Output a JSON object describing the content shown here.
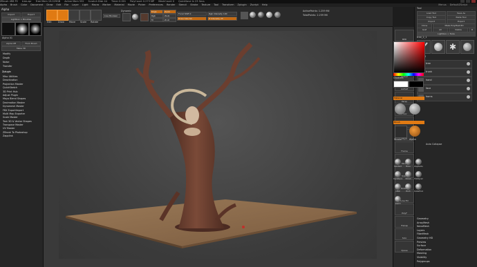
{
  "titlebar": {
    "items": [
      "ZBrush 4R8 P2",
      "tree.zpr",
      "Free Mem 19.029GB",
      "Active Mem 552",
      "Scratch Disk 44",
      "Timer 0.001",
      "PolyCount 0.273 MP",
      "MeshCount 0",
      "QuickSave In 23 Secs"
    ]
  },
  "menubar": {
    "items": [
      "Alpha",
      "Brush",
      "Color",
      "Document",
      "Draw",
      "Edit",
      "File",
      "Layer",
      "Light",
      "Macro",
      "Marker",
      "Material",
      "Movie",
      "Picker",
      "Preferences",
      "Render",
      "Stencil",
      "Stroke",
      "Texture",
      "Tool",
      "Transform",
      "Zplugin",
      "Zscript",
      "Help"
    ],
    "right_items": [
      "Menus",
      "DefaultZScript"
    ]
  },
  "left_panel": {
    "title": "Alpha",
    "lightbox_label": "Lightbox > Brushes",
    "brush_label": "Alpha 01",
    "buttons": [
      "Import",
      "Export",
      "Alpha Off",
      "From Brush",
      "Make 3D"
    ],
    "plugins_header": "Zplugin",
    "plugins": [
      "Misc Utilities",
      "Deactivation",
      "Projection Master",
      "QuickSketch",
      "3D Print Hub",
      "Adjust Plugin",
      "Maya Blend Shapes",
      "Decimation Master",
      "Dynamesh Master",
      "FBX ExportImport",
      "Multi Map Exporter",
      "Scale Master",
      "Text 3D & Vector Shapes",
      "Transpose Master",
      "UV Master",
      "ZBrush To Photoshop",
      "Zapplink"
    ],
    "top_list": [
      "Modify",
      "Depth",
      "Noise",
      "Transfer"
    ]
  },
  "toolbar": {
    "mode_labels": [
      "Edit",
      "Draw",
      "Move",
      "Scale",
      "Rotate"
    ],
    "livebool_label": "Live Boolean",
    "dynamic_label": "Dynamic",
    "mrgb_label": "Mrgb",
    "rgb_label": "Rgb",
    "m_label": "M",
    "zadd_label": "Zadd",
    "zsub_label": "Zsub",
    "zcut_label": "Zcut",
    "focal_shift": "Focal Shift 0",
    "draw_size": "Draw Size 64",
    "rgb_intensity": "Rgb Intensity 100",
    "z_intensity": "Z Intensity 25",
    "active_points": "ActivePoints: 1.259 Mil",
    "total_points": "TotalPoints: 2.259 Mil",
    "persp_label": "Persp",
    "floor_label": "Floor"
  },
  "shelf_labels": [
    "BPR",
    "Scroll",
    "Zoom",
    "Actual",
    "AAHalf",
    "Persp",
    "Floor",
    "Local",
    "LSym",
    "Frame",
    "Move",
    "Scale",
    "Rotate",
    "Line Fill",
    "PolyF",
    "Transp",
    "Solo",
    "Xpose"
  ],
  "right_panel": {
    "header": "Tool",
    "buttons": [
      "Load Tool",
      "Save As",
      "Copy Tool",
      "Paste Tool",
      "Import",
      "Export",
      "Clone",
      "Make PolyMesh3D",
      "GoZ",
      "All",
      "Visible",
      "R"
    ],
    "lightbox_label": "Lightbox > Tools",
    "tool_name": "tree_2_1",
    "subtool_header": "Subtool",
    "subtool_items": [
      "tree",
      "trunk",
      "hand",
      "face",
      "horns"
    ],
    "menu_items": [
      "Geometry",
      "ArrayMesh",
      "NanoMesh",
      "Layers",
      "FiberMesh",
      "Geometry HD",
      "Preview",
      "Surface",
      "Deformation",
      "Masking",
      "Visibility",
      "Polygroups"
    ],
    "color_section": "Color",
    "gradient_label": "Gradient",
    "switch_label": "SwitchColor",
    "alternate_label": "Alternate",
    "material_label": "Material",
    "brush_section": "Brush",
    "brush_labels": [
      "Standard",
      "Move",
      "ClayBuildup",
      "DamStandard",
      "hPolish",
      "TrimDynamic",
      "Inflat",
      "Pinch",
      "SnakeHook",
      "Slash3"
    ],
    "fill_label": "FillObject",
    "pickup_label": "PickUp",
    "stroke_label": "Stroke",
    "alpha_label": "Alpha",
    "texture_label": "Texture",
    "mirror_label": "Mirror",
    "split_label": "Split",
    "merge_label": "Merge",
    "remesh_label": "Remesh",
    "project_label": "Project",
    "extract_label": "Extract",
    "autocollapse_label": "Auto Collapse"
  },
  "colors": {
    "accent": "#e07a13",
    "bg_dark": "#1d1d1d",
    "viewport": "#3a3a3a",
    "tree_brown": "#6f4233",
    "floor": "#8a6a4b"
  }
}
